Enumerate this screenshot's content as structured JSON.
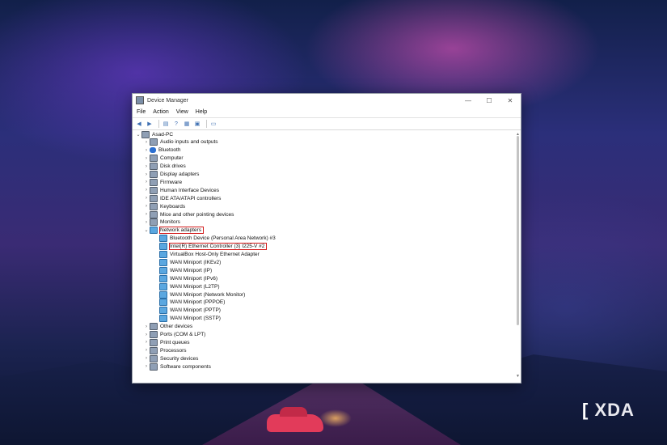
{
  "window": {
    "title": "Device Manager",
    "controls": {
      "minimize": "—",
      "maximize": "☐",
      "close": "✕"
    }
  },
  "menu": [
    "File",
    "Action",
    "View",
    "Help"
  ],
  "toolbar_icons": [
    "back-arrow-icon",
    "forward-arrow-icon",
    "properties-icon",
    "help-icon",
    "view-icon",
    "update-driver-icon",
    "scan-hardware-icon"
  ],
  "tree": {
    "root": "Asad-PC",
    "categories_top": [
      "Audio inputs and outputs",
      "Bluetooth",
      "Computer",
      "Disk drives",
      "Display adapters",
      "Firmware",
      "Human Interface Devices",
      "IDE ATA/ATAPI controllers",
      "Keyboards",
      "Mice and other pointing devices",
      "Monitors"
    ],
    "expanded": "Network adapters",
    "network_children": [
      "Bluetooth Device (Personal Area Network) #3",
      "Intel(R) Ethernet Controller (3) I225-V #2",
      "VirtualBox Host-Only Ethernet Adapter",
      "WAN Miniport (IKEv2)",
      "WAN Miniport (IP)",
      "WAN Miniport (IPv6)",
      "WAN Miniport (L2TP)",
      "WAN Miniport (Network Monitor)",
      "WAN Miniport (PPPOE)",
      "WAN Miniport (PPTP)",
      "WAN Miniport (SSTP)"
    ],
    "categories_bottom": [
      "Other devices",
      "Ports (COM & LPT)",
      "Print queues",
      "Processors",
      "Security devices",
      "Software components"
    ]
  },
  "brand": {
    "logo_text": "XDA",
    "bracket": "["
  },
  "colors": {
    "highlight": "#d21a1a",
    "accent": "#3e6fb2"
  }
}
